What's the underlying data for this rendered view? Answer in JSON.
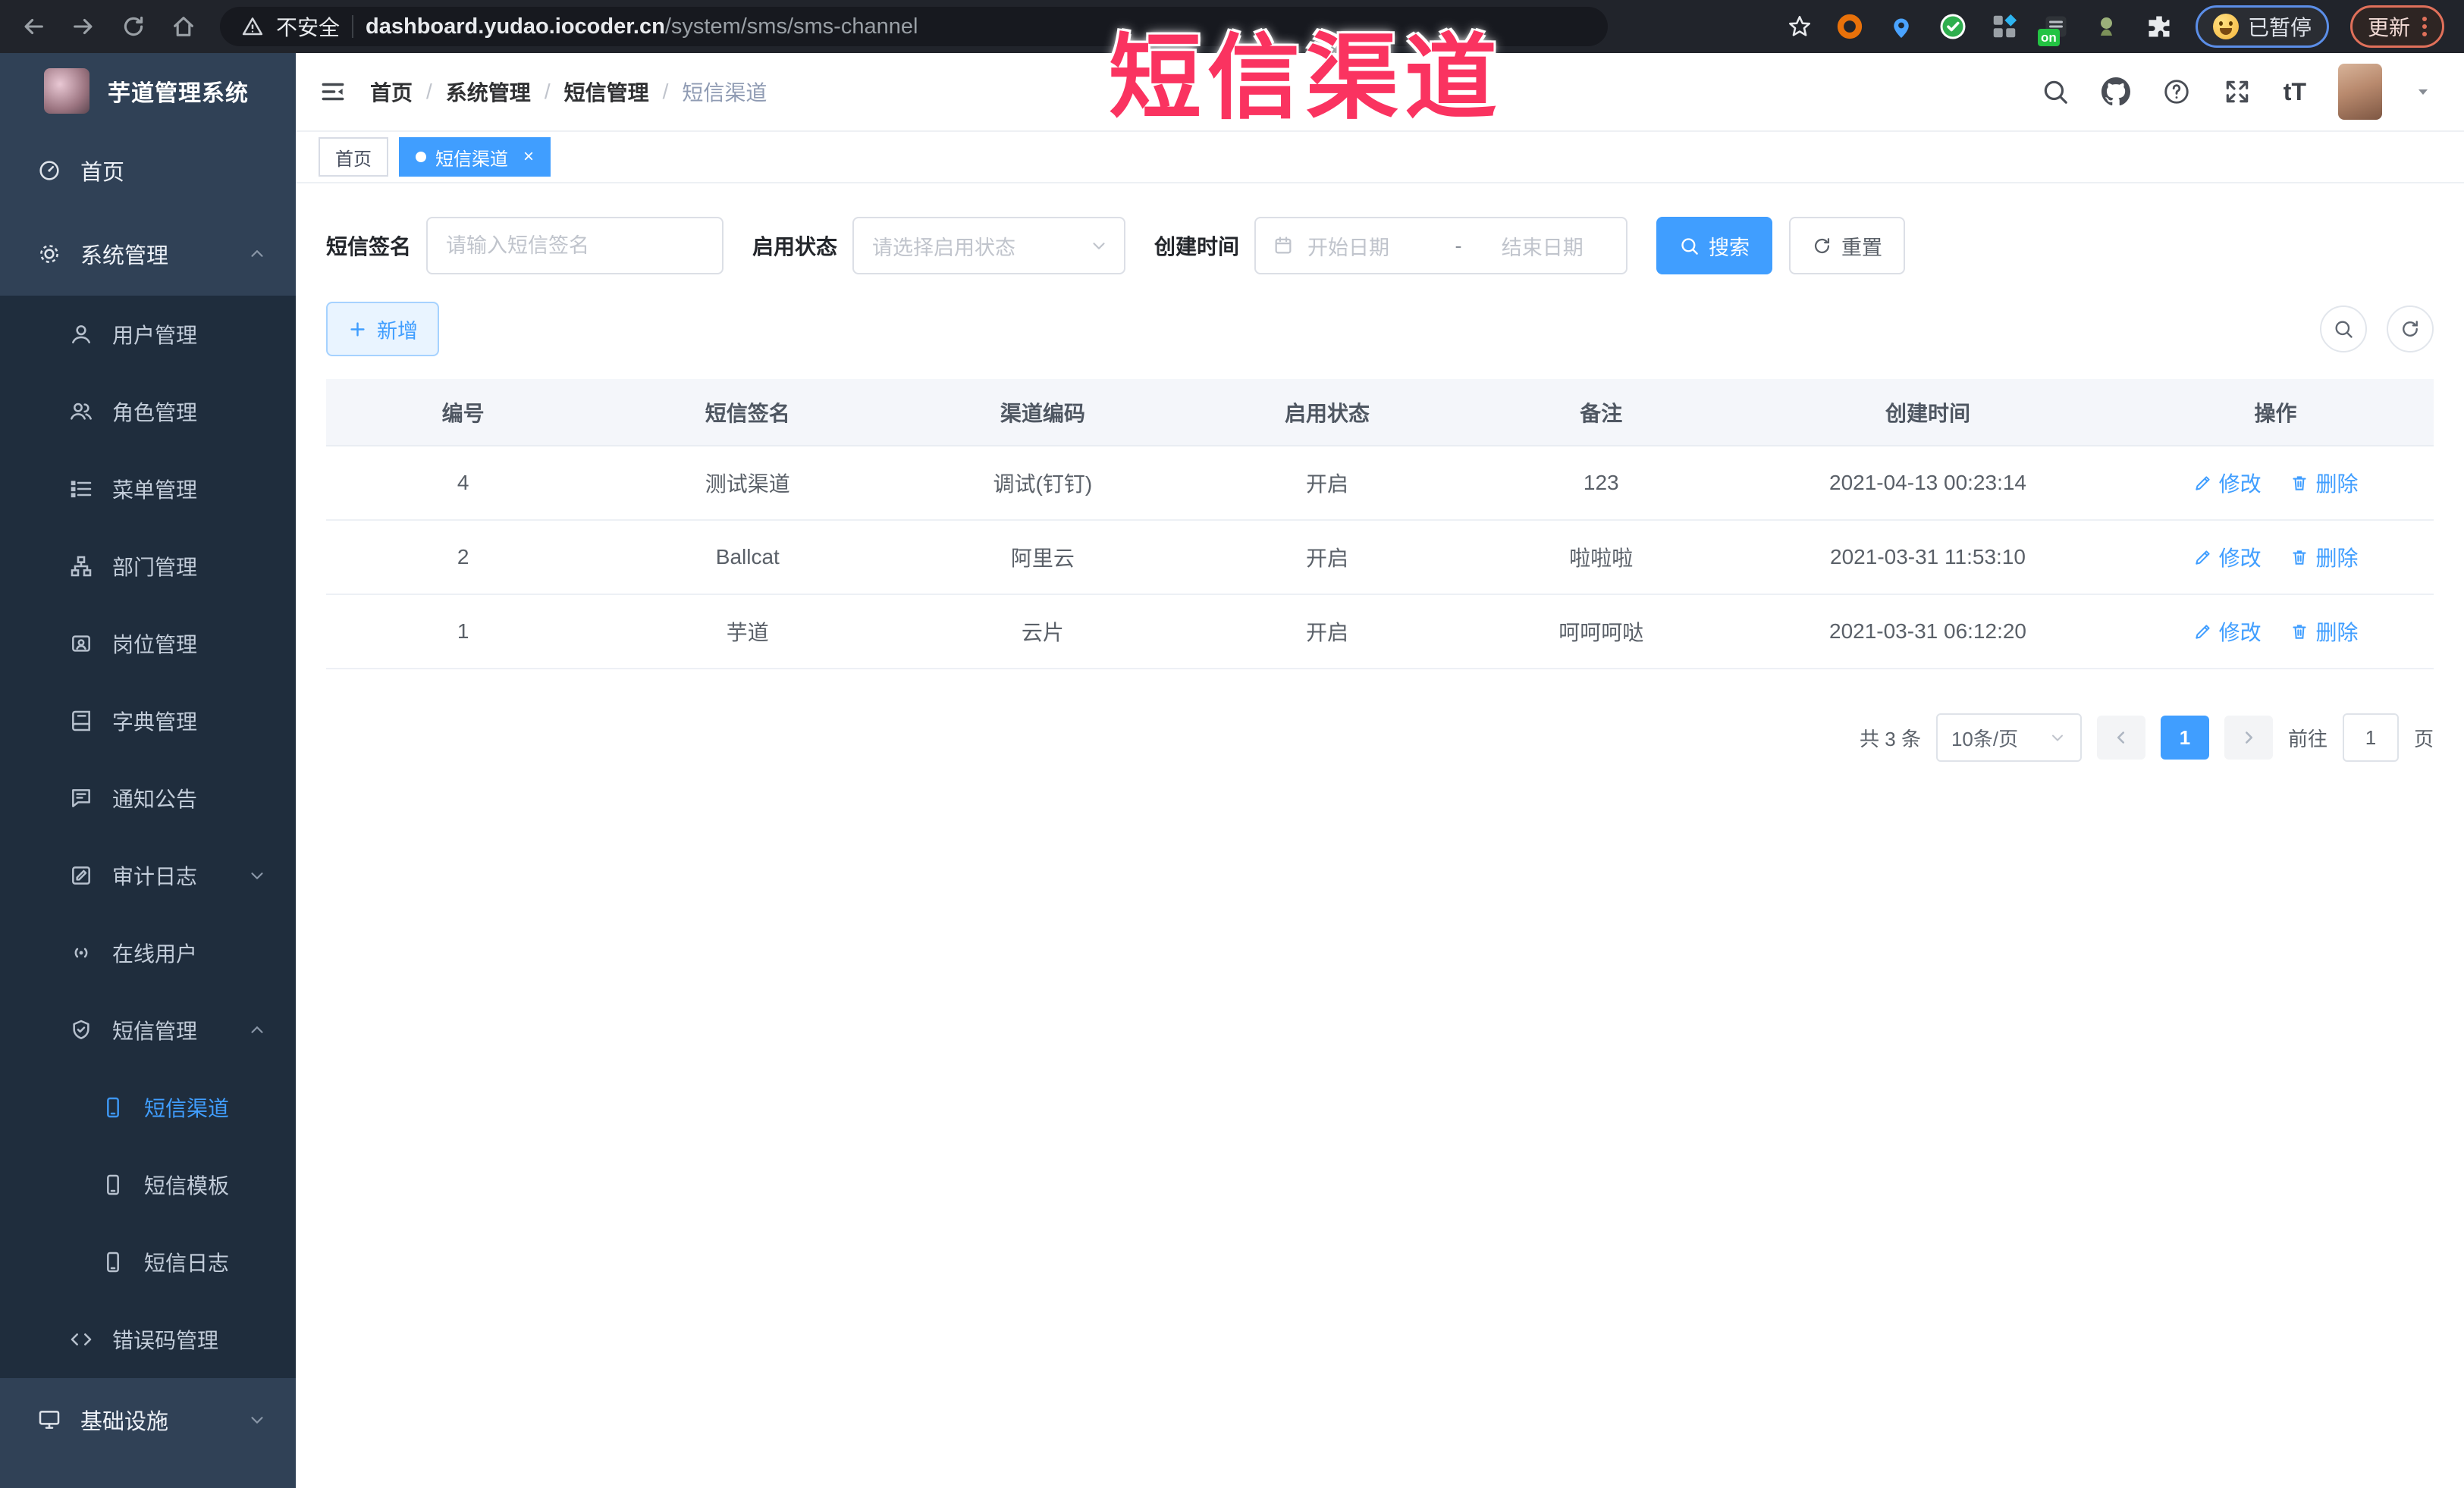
{
  "overlay_title": "短信渠道",
  "colors": {
    "accent": "#409eff",
    "overlay_pink": "#fa3360",
    "sidebar_bg": "#304156",
    "submenu_bg": "#1f2d3d",
    "table_header_bg": "#f4f6fa"
  },
  "browser": {
    "security_label": "不安全",
    "url_domain": "dashboard.yudao.iocoder.cn",
    "url_path": "/system/sms/sms-channel",
    "ext_on_badge": "on",
    "paused_label": "已暂停",
    "update_label": "更新"
  },
  "sidebar": {
    "app_title": "芋道管理系统",
    "items": {
      "home": "首页",
      "system": "系统管理",
      "user": "用户管理",
      "role": "角色管理",
      "menu": "菜单管理",
      "dept": "部门管理",
      "post": "岗位管理",
      "dict": "字典管理",
      "notice": "通知公告",
      "audit": "审计日志",
      "online": "在线用户",
      "sms": "短信管理",
      "sms_channel": "短信渠道",
      "sms_template": "短信模板",
      "sms_log": "短信日志",
      "errcode": "错误码管理",
      "infra": "基础设施"
    }
  },
  "header": {
    "breadcrumb": [
      "首页",
      "系统管理",
      "短信管理",
      "短信渠道"
    ],
    "font_size_label": "tT"
  },
  "tags": {
    "home": "首页",
    "current": "短信渠道",
    "close": "×"
  },
  "filters": {
    "signature_label": "短信签名",
    "signature_placeholder": "请输入短信签名",
    "status_label": "启用状态",
    "status_placeholder": "请选择启用状态",
    "time_label": "创建时间",
    "start_placeholder": "开始日期",
    "separator": "-",
    "end_placeholder": "结束日期",
    "search_label": "搜索",
    "reset_label": "重置"
  },
  "toolbar": {
    "add_label": "新增"
  },
  "table": {
    "headers": [
      "编号",
      "短信签名",
      "渠道编码",
      "启用状态",
      "备注",
      "创建时间",
      "操作"
    ],
    "edit_label": "修改",
    "delete_label": "删除",
    "rows": [
      {
        "id": "4",
        "signature": "测试渠道",
        "code": "调试(钉钉)",
        "status": "开启",
        "remark": "123",
        "created": "2021-04-13 00:23:14"
      },
      {
        "id": "2",
        "signature": "Ballcat",
        "code": "阿里云",
        "status": "开启",
        "remark": "啦啦啦",
        "created": "2021-03-31 11:53:10"
      },
      {
        "id": "1",
        "signature": "芋道",
        "code": "云片",
        "status": "开启",
        "remark": "呵呵呵哒",
        "created": "2021-03-31 06:12:20"
      }
    ]
  },
  "pagination": {
    "total": "共 3 条",
    "page_size": "10条/页",
    "page": "1",
    "goto_label": "前往",
    "goto_value": "1",
    "page_unit": "页"
  }
}
